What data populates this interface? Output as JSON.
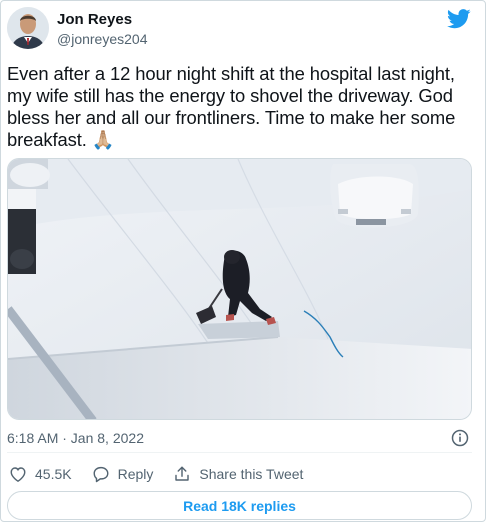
{
  "author": {
    "name": "Jon Reyes",
    "handle": "@jonreyes204"
  },
  "tweet": {
    "text": "Even after a 12 hour night shift at the hospital last night, my wife still has the energy to shovel the driveway. God bless her and all our frontliners. Time to make her some breakfast. 🙏🏼"
  },
  "meta": {
    "timestamp": "6:18 AM · Jan 8, 2022"
  },
  "actions": {
    "likes": "45.5K",
    "reply_label": "Reply",
    "share_label": "Share this Tweet"
  },
  "footer": {
    "read_replies_label": "Read 18K replies"
  },
  "colors": {
    "accent": "#1d9bf0",
    "like": "#536471",
    "text": "#0f1419",
    "secondary": "#536471"
  },
  "icons": {
    "brand": "twitter-bird-icon",
    "info": "info-icon",
    "like": "heart-icon",
    "reply": "reply-bubble-icon",
    "share": "share-icon"
  }
}
